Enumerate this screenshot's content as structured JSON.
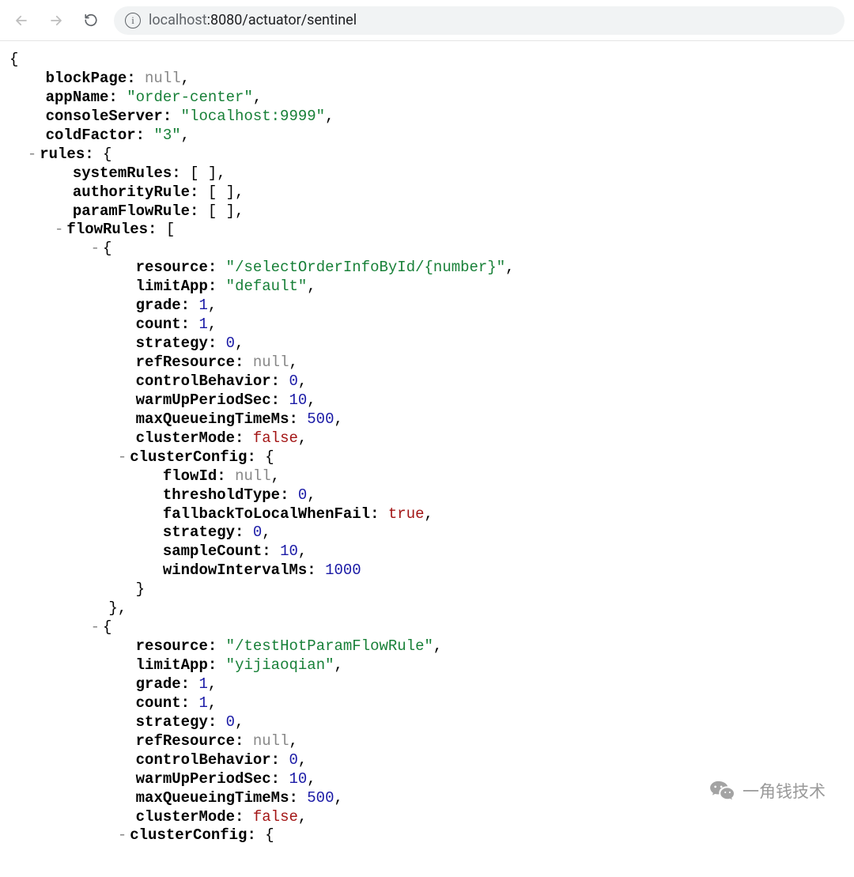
{
  "toolbar": {
    "url_display_dim": "localhost",
    "url_display_rest": ":8080/actuator/sentinel"
  },
  "watermark": {
    "text": "一角钱技术"
  },
  "json": {
    "blockPage": null,
    "appName": "order-center",
    "consoleServer": "localhost:9999",
    "coldFactor": "3",
    "rules": {
      "systemRules": [],
      "authorityRule": [],
      "paramFlowRule": [],
      "flowRules": [
        {
          "resource": "/selectOrderInfoById/{number}",
          "limitApp": "default",
          "grade": 1,
          "count": 1,
          "strategy": 0,
          "refResource": null,
          "controlBehavior": 0,
          "warmUpPeriodSec": 10,
          "maxQueueingTimeMs": 500,
          "clusterMode": false,
          "clusterConfig": {
            "flowId": null,
            "thresholdType": 0,
            "fallbackToLocalWhenFail": true,
            "strategy": 0,
            "sampleCount": 10,
            "windowIntervalMs": 1000
          }
        },
        {
          "resource": "/testHotParamFlowRule",
          "limitApp": "yijiaoqian",
          "grade": 1,
          "count": 1,
          "strategy": 0,
          "refResource": null,
          "controlBehavior": 0,
          "warmUpPeriodSec": 10,
          "maxQueueingTimeMs": 500,
          "clusterMode": false,
          "clusterConfig": {}
        }
      ]
    }
  }
}
